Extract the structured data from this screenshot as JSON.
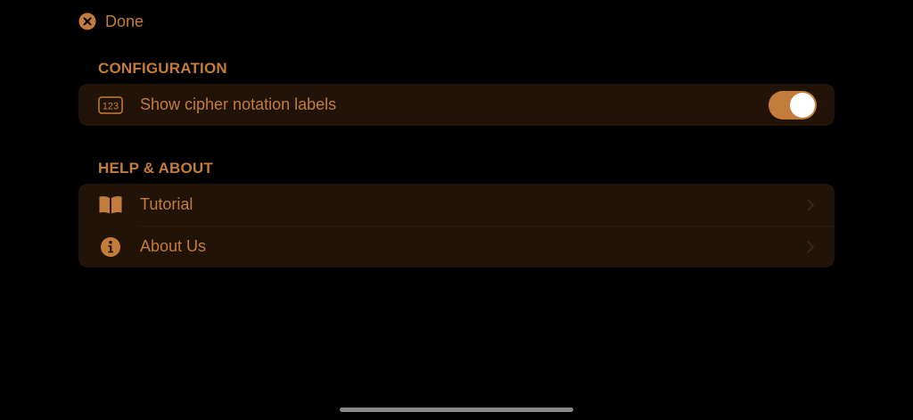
{
  "header": {
    "done_label": "Done",
    "done_icon": "close-circle-icon"
  },
  "sections": [
    {
      "title": "CONFIGURATION",
      "rows": [
        {
          "label": "Show cipher notation labels",
          "icon": "number-123-icon",
          "icon_text": "123",
          "control": "toggle",
          "toggle_on": true
        }
      ]
    },
    {
      "title": "HELP & ABOUT",
      "rows": [
        {
          "label": "Tutorial",
          "icon": "book-icon",
          "control": "chevron"
        },
        {
          "label": "About Us",
          "icon": "info-circle-icon",
          "control": "chevron"
        }
      ]
    }
  ],
  "colors": {
    "accent": "#c47c3a",
    "group_background": "#221309",
    "page_background": "#000000"
  }
}
